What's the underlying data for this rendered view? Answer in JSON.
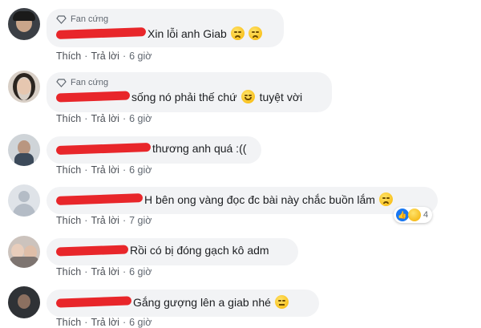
{
  "comments": [
    {
      "badge": "Fan cứng",
      "text": "Xin lỗi anh Giab",
      "emoji": [
        "pensive-face",
        "pensive-face"
      ],
      "actions": {
        "like": "Thích",
        "reply": "Trả lời",
        "time": "6 giờ"
      }
    },
    {
      "badge": "Fan cứng",
      "text": "sống nó phải thế chứ",
      "emoji": [
        "smiling-face"
      ],
      "tail": "tuyệt vời",
      "actions": {
        "like": "Thích",
        "reply": "Trả lời",
        "time": "6 giờ"
      }
    },
    {
      "text": "thương anh quá :((",
      "actions": {
        "like": "Thích",
        "reply": "Trả lời",
        "time": "6 giờ"
      }
    },
    {
      "text": "H bên ong vàng đọc đc bài này chắc buồn lắm",
      "emoji": [
        "pensive-face"
      ],
      "reactions": {
        "types": [
          "like",
          "sad"
        ],
        "count": "4"
      },
      "actions": {
        "like": "Thích",
        "reply": "Trả lời",
        "time": "7 giờ"
      }
    },
    {
      "text": "Rồi có bị đóng gạch kô adm",
      "actions": {
        "like": "Thích",
        "reply": "Trả lời",
        "time": "6 giờ"
      }
    },
    {
      "text": "Gắng gượng lên a giab nhé",
      "emoji": [
        "worried-face"
      ],
      "actions": {
        "like": "Thích",
        "reply": "Trả lời",
        "time": "6 giờ"
      }
    }
  ],
  "separator": "·",
  "colors": {
    "bubble": "#f2f3f5",
    "redaction": "#e8262a",
    "link": "#4b4f56",
    "like_blue": "#1877f2"
  }
}
